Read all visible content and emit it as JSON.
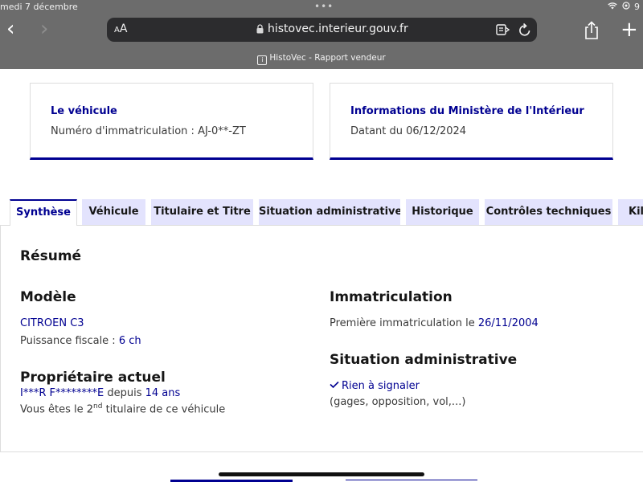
{
  "status_bar": {
    "date": "medi 7 décembre",
    "right": "9"
  },
  "browser": {
    "aa_label": "A",
    "aa_small": "A",
    "url": "histovec.interieur.gouv.fr",
    "page_title": "HistoVec - Rapport vendeur",
    "favicon_letter": "i",
    "plus_label": "+",
    "back_label": "‹",
    "forward_label": "›",
    "dots": "•••"
  },
  "cards": {
    "vehicle": {
      "title": "Le véhicule",
      "text": "Numéro d'immatriculation : AJ-0**-ZT"
    },
    "ministry": {
      "title": "Informations du Ministère de l'Intérieur",
      "text": "Datant du 06/12/2024"
    }
  },
  "tabs": [
    {
      "label": "Synthèse"
    },
    {
      "label": "Véhicule"
    },
    {
      "label": "Titulaire et Titre"
    },
    {
      "label": "Situation administrative"
    },
    {
      "label": "Historique"
    },
    {
      "label": "Contrôles techniques"
    },
    {
      "label": "Kilo"
    }
  ],
  "summary": {
    "heading": "Résumé",
    "model": {
      "heading": "Modèle",
      "name": "CITROEN C3",
      "power_label": "Puissance fiscale : ",
      "power_value": "6 ch"
    },
    "owner": {
      "heading": "Propriétaire actuel",
      "name": "I***R F********E",
      "since_label": " depuis ",
      "since_value": "14 ans",
      "rank_prefix": "Vous êtes le ",
      "rank_number": "2",
      "rank_suffix": "nd",
      "rank_end": " titulaire de ce véhicule"
    },
    "registration": {
      "heading": "Immatriculation",
      "label": "Première immatriculation le ",
      "date": "26/11/2004"
    },
    "admin": {
      "heading": "Situation administrative",
      "status": "Rien à signaler",
      "detail": "(gages, opposition, vol,...)"
    }
  },
  "colors": {
    "brand_blue": "#000091",
    "tab_bg": "#e3e3fd",
    "chrome_bg": "#6c6c6c"
  }
}
